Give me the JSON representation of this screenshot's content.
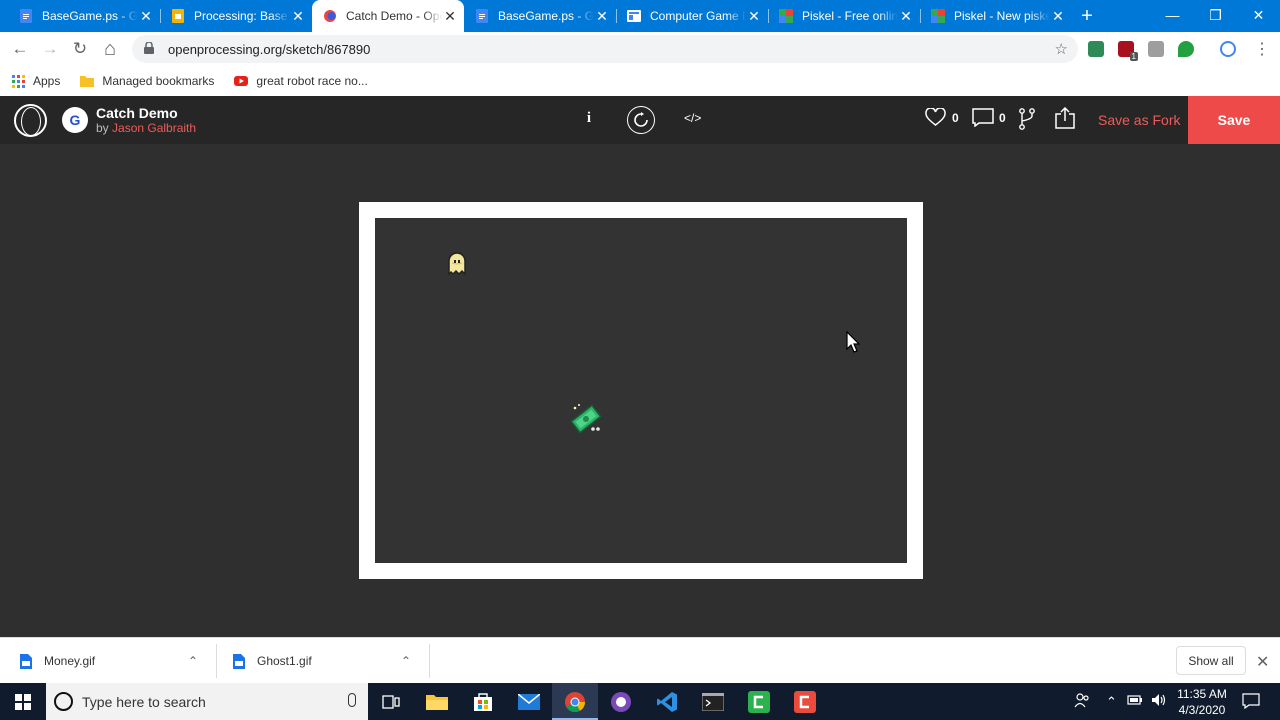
{
  "browser": {
    "tabs": [
      {
        "title": "BaseGame.ps - Google Docs",
        "icon": "google-docs-icon",
        "color": "#4285f4",
        "active": false
      },
      {
        "title": "Processing: Base Game",
        "icon": "google-slides-icon",
        "color": "#f4b400",
        "active": false
      },
      {
        "title": "Catch Demo - OpenProcessing",
        "icon": "openprocessing-icon",
        "color": "#e84545",
        "active": true
      },
      {
        "title": "BaseGame.ps - Google Docs",
        "icon": "google-docs-icon",
        "color": "#4285f4",
        "active": false
      },
      {
        "title": "Computer Game Design",
        "icon": "google-sites-icon",
        "color": "#4285f4",
        "active": false
      },
      {
        "title": "Piskel - Free online sprite editor",
        "icon": "piskel-icon",
        "color": "#34a853",
        "active": false
      },
      {
        "title": "Piskel - New piskel",
        "icon": "piskel-icon",
        "color": "#34a853",
        "active": false
      }
    ],
    "tab_close_glyph": "✕",
    "new_tab_glyph": "+",
    "window_controls": {
      "minimize": "—",
      "restore": "❐",
      "close": "✕"
    },
    "nav": {
      "back": "←",
      "forward": "→",
      "reload": "↻",
      "home": "⌂"
    },
    "url": "openprocessing.org/sketch/867890",
    "lock_glyph": "🔒",
    "star_glyph": "☆",
    "menu_glyph": "⋮",
    "extensions": [
      {
        "name": "extension-green-icon",
        "color": "#2e8b57"
      },
      {
        "name": "extension-shield-icon",
        "color": "#a8101e"
      },
      {
        "name": "extension-acrobat-icon",
        "color": "#9e9e9e"
      },
      {
        "name": "extension-leaf-icon",
        "color": "#22a042"
      },
      {
        "name": "extension-google-icon",
        "color": "#4285f4"
      }
    ],
    "extension_badge": "1",
    "bookmarks": [
      {
        "label": "Apps",
        "icon": "apps-grid-icon"
      },
      {
        "label": "Managed bookmarks",
        "icon": "folder-icon"
      },
      {
        "label": "great robot race no...",
        "icon": "youtube-icon"
      }
    ]
  },
  "sketch": {
    "title": "Catch Demo",
    "by_prefix": "by ",
    "author": "Jason Galbraith",
    "author_avatar_letter": "G",
    "info_label": "i",
    "code_label": "</>",
    "likes": "0",
    "comments": "0",
    "save_as_fork": "Save as Fork",
    "save": "Save",
    "accent": "#ef4a4a"
  },
  "downloads": {
    "items": [
      {
        "name": "Money.gif",
        "caret": "⌃"
      },
      {
        "name": "Ghost1.gif",
        "caret": "⌃"
      }
    ],
    "show_all": "Show all",
    "close_glyph": "✕"
  },
  "taskbar": {
    "search_placeholder": "Type here to search",
    "time": "11:35 AM",
    "date": "4/3/2020",
    "tray_caret": "⌃"
  }
}
